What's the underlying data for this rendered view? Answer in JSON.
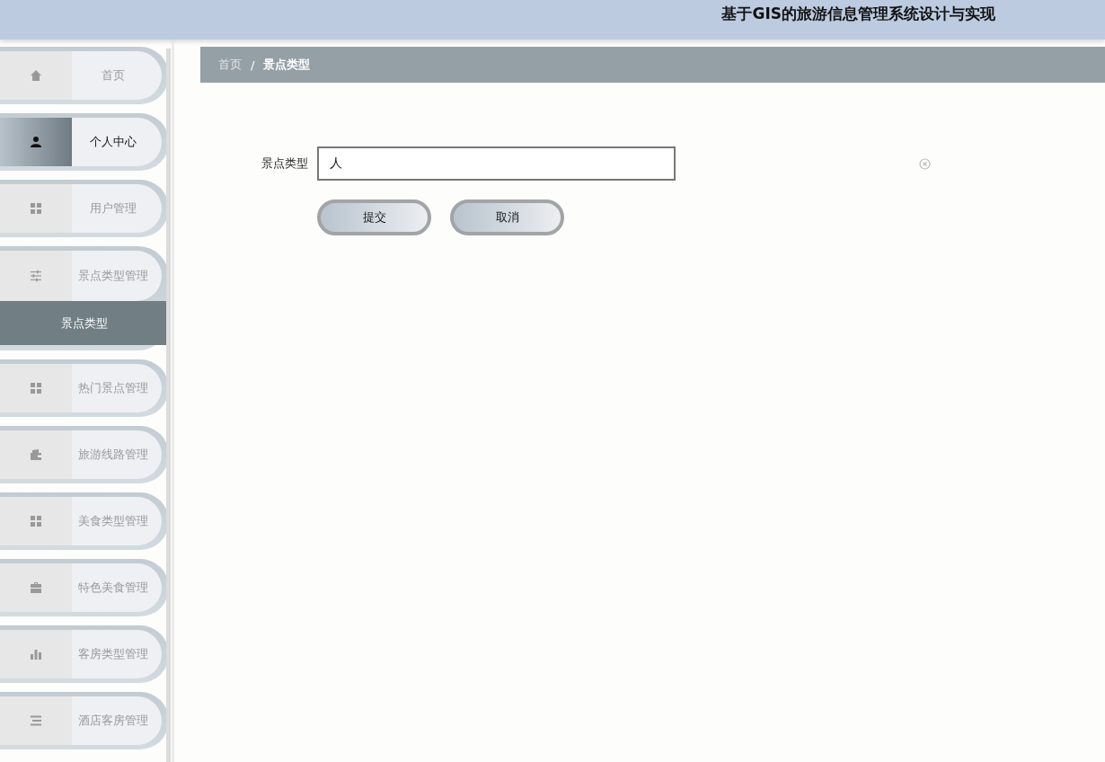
{
  "header": {
    "title": "基于GIS的旅游信息管理系统设计与实现"
  },
  "sidebar": {
    "items": [
      {
        "label": "首页",
        "selected": false,
        "expanded": false
      },
      {
        "label": "个人中心",
        "selected": true,
        "expanded": false
      },
      {
        "label": "用户管理",
        "selected": false,
        "expanded": false
      },
      {
        "label": "景点类型管理",
        "selected": false,
        "expanded": true,
        "children": [
          {
            "label": "景点类型",
            "selected": true
          }
        ]
      },
      {
        "label": "热门景点管理",
        "selected": false,
        "expanded": false
      },
      {
        "label": "旅游线路管理",
        "selected": false,
        "expanded": false
      },
      {
        "label": "美食类型管理",
        "selected": false,
        "expanded": false
      },
      {
        "label": "特色美食管理",
        "selected": false,
        "expanded": false
      },
      {
        "label": "客房类型管理",
        "selected": false,
        "expanded": false
      },
      {
        "label": "酒店客房管理",
        "selected": false,
        "expanded": false
      }
    ]
  },
  "breadcrumb": {
    "items": [
      {
        "label": "首页"
      },
      {
        "label": "景点类型"
      }
    ],
    "separator": "/"
  },
  "form": {
    "fields": [
      {
        "label": "景点类型",
        "value": "人"
      }
    ],
    "buttons": [
      {
        "label": "提交"
      },
      {
        "label": "取消"
      }
    ]
  }
}
